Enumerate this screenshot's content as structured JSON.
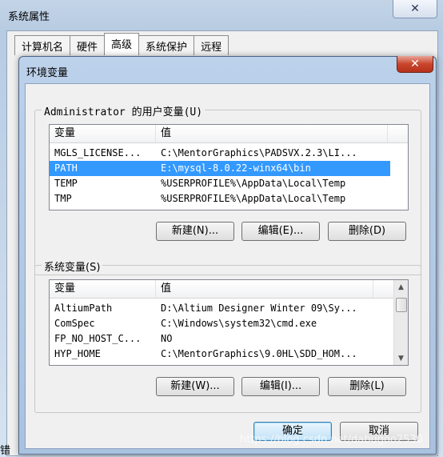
{
  "background_window": {
    "title": "系统属性",
    "close_glyph": "✕",
    "tabs": [
      {
        "label": "计算机名"
      },
      {
        "label": "硬件"
      },
      {
        "label": "高级"
      },
      {
        "label": "系统保护"
      },
      {
        "label": "远程"
      }
    ],
    "bottom_text": "错"
  },
  "dialog": {
    "title": "环境变量",
    "close_glyph": "✕",
    "user_vars": {
      "group_label": "Administrator 的用户变量(U)",
      "columns": {
        "name": "变量",
        "value": "值"
      },
      "rows": [
        {
          "name": "MGLS_LICENSE...",
          "value": "C:\\MentorGraphics\\PADSVX.2.3\\LI..."
        },
        {
          "name": "PATH",
          "value": "E:\\mysql-8.0.22-winx64\\bin",
          "selected": true
        },
        {
          "name": "TEMP",
          "value": "%USERPROFILE%\\AppData\\Local\\Temp"
        },
        {
          "name": "TMP",
          "value": "%USERPROFILE%\\AppData\\Local\\Temp"
        }
      ],
      "buttons": {
        "new": "新建(N)...",
        "edit": "编辑(E)...",
        "delete": "删除(D)"
      }
    },
    "system_vars": {
      "group_label": "系统变量(S)",
      "columns": {
        "name": "变量",
        "value": "值"
      },
      "rows": [
        {
          "name": "AltiumPath",
          "value": "D:\\Altium Designer Winter 09\\Sy..."
        },
        {
          "name": "ComSpec",
          "value": "C:\\Windows\\system32\\cmd.exe"
        },
        {
          "name": "FP_NO_HOST_C...",
          "value": "NO"
        },
        {
          "name": "HYP_HOME",
          "value": "C:\\MentorGraphics\\9.0HL\\SDD_HOM..."
        }
      ],
      "buttons": {
        "new": "新建(W)...",
        "edit": "编辑(I)...",
        "delete": "删除(L)"
      }
    },
    "ok_label": "确定",
    "cancel_label": "取消"
  },
  "watermark": "https://blog.csdn.net/dabugoo2530"
}
